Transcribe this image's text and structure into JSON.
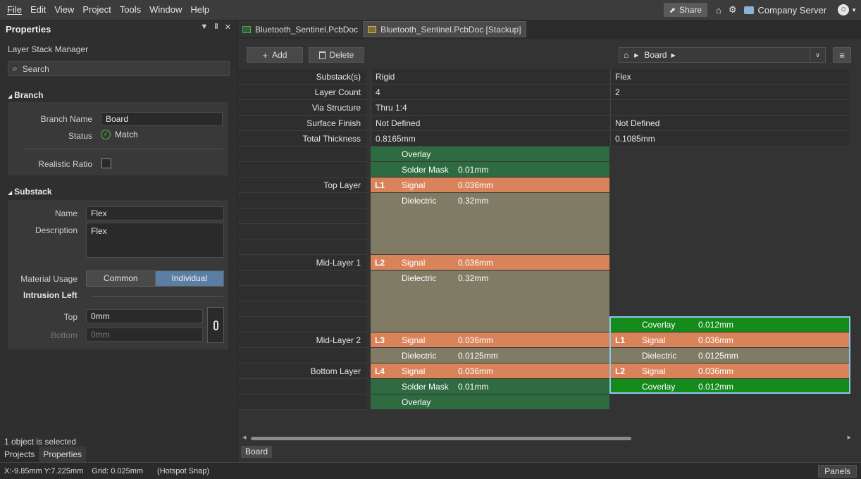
{
  "menubar": {
    "items": [
      "File",
      "Edit",
      "View",
      "Project",
      "Tools",
      "Window",
      "Help"
    ],
    "share_label": "Share",
    "server_label": "Company Server"
  },
  "properties_panel": {
    "title": "Properties",
    "subtitle": "Layer Stack Manager",
    "search_placeholder": "Search",
    "branch": {
      "heading": "Branch",
      "branch_name_label": "Branch Name",
      "branch_name_value": "Board",
      "status_label": "Status",
      "status_value": "Match",
      "realistic_ratio_label": "Realistic Ratio"
    },
    "substack": {
      "heading": "Substack",
      "name_label": "Name",
      "name_value": "Flex",
      "description_label": "Description",
      "description_value": "Flex",
      "material_usage_label": "Material Usage",
      "material_options": [
        "Common",
        "Individual"
      ],
      "material_selected": "Individual",
      "intrusion_heading": "Intrusion Left",
      "top_label": "Top",
      "top_value": "0mm",
      "bottom_label": "Bottom",
      "bottom_value": "0mm"
    },
    "selection_status": "1 object is selected",
    "tabs": [
      "Projects",
      "Properties"
    ]
  },
  "doc_tabs": [
    {
      "label": "Bluetooth_Sentinel.PcbDoc",
      "icon_color": "#3fae49"
    },
    {
      "label": "Bluetooth_Sentinel.PcbDoc [Stackup]",
      "icon_color": "#d8b43a"
    }
  ],
  "toolbar": {
    "add_label": "Add",
    "delete_label": "Delete",
    "breadcrumb": "Board"
  },
  "properties_rows": [
    {
      "label": "Substack(s)",
      "rigid": "Rigid",
      "flex": "Flex"
    },
    {
      "label": "Layer Count",
      "rigid": "4",
      "flex": "2"
    },
    {
      "label": "Via Structure",
      "rigid": "Thru 1:4",
      "flex": ""
    },
    {
      "label": "Surface Finish",
      "rigid": "Not Defined",
      "flex": "Not Defined"
    },
    {
      "label": "Total Thickness",
      "rigid": "0.8165mm",
      "flex": "0.1085mm"
    }
  ],
  "rigid_layers": [
    {
      "row": 0,
      "span": 1,
      "id": "",
      "type": "Overlay",
      "thickness": "",
      "kind": "overlay"
    },
    {
      "row": 1,
      "span": 1,
      "id": "",
      "type": "Solder Mask",
      "thickness": "0.01mm",
      "kind": "mask"
    },
    {
      "row": 2,
      "span": 1,
      "id": "L1",
      "type": "Signal",
      "thickness": "0.036mm",
      "kind": "signal"
    },
    {
      "row": 3,
      "span": 4,
      "id": "",
      "type": "Dielectric",
      "thickness": "0.32mm",
      "kind": "dielectric"
    },
    {
      "row": 7,
      "span": 1,
      "id": "L2",
      "type": "Signal",
      "thickness": "0.036mm",
      "kind": "signal"
    },
    {
      "row": 8,
      "span": 4,
      "id": "",
      "type": "Dielectric",
      "thickness": "0.32mm",
      "kind": "dielectric"
    },
    {
      "row": 12,
      "span": 1,
      "id": "L3",
      "type": "Signal",
      "thickness": "0.036mm",
      "kind": "signal"
    },
    {
      "row": 13,
      "span": 1,
      "id": "",
      "type": "Dielectric",
      "thickness": "0.0125mm",
      "kind": "dielectric"
    },
    {
      "row": 14,
      "span": 1,
      "id": "L4",
      "type": "Signal",
      "thickness": "0.036mm",
      "kind": "signal"
    },
    {
      "row": 15,
      "span": 1,
      "id": "",
      "type": "Solder Mask",
      "thickness": "0.01mm",
      "kind": "mask"
    },
    {
      "row": 16,
      "span": 1,
      "id": "",
      "type": "Overlay",
      "thickness": "",
      "kind": "overlay"
    }
  ],
  "flex_layers": [
    {
      "row": 11,
      "span": 1,
      "id": "",
      "type": "Coverlay",
      "thickness": "0.012mm",
      "kind": "coverlay"
    },
    {
      "row": 12,
      "span": 1,
      "id": "L1",
      "type": "Signal",
      "thickness": "0.036mm",
      "kind": "signal"
    },
    {
      "row": 13,
      "span": 1,
      "id": "",
      "type": "Dielectric",
      "thickness": "0.0125mm",
      "kind": "dielectric"
    },
    {
      "row": 14,
      "span": 1,
      "id": "L2",
      "type": "Signal",
      "thickness": "0.036mm",
      "kind": "signal"
    },
    {
      "row": 15,
      "span": 1,
      "id": "",
      "type": "Coverlay",
      "thickness": "0.012mm",
      "kind": "coverlay"
    }
  ],
  "layer_names": [
    {
      "row": 2,
      "name": "Top Layer"
    },
    {
      "row": 7,
      "name": "Mid-Layer 1"
    },
    {
      "row": 12,
      "name": "Mid-Layer 2"
    },
    {
      "row": 14,
      "name": "Bottom Layer"
    }
  ],
  "layer_colors": {
    "overlay": "#2e6b40",
    "mask": "#2e6b40",
    "signal": "#d9835a",
    "dielectric": "#7f7b64",
    "coverlay": "#138a1a"
  },
  "board_tab": "Board",
  "statusbar": {
    "coords": "X:-9.85mm Y:7.225mm",
    "grid": "Grid: 0.025mm",
    "snap": "(Hotspot Snap)",
    "panels_label": "Panels"
  }
}
